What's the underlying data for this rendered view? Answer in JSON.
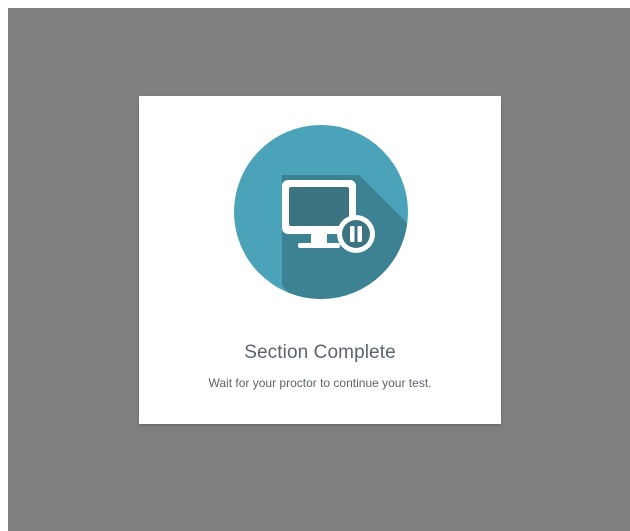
{
  "dialog": {
    "title": "Section Complete",
    "message": "Wait for your proctor to continue your test."
  },
  "illustration": {
    "icon": "monitor-paused-icon",
    "circle_color": "#4aa3b9",
    "shadow_color": "#3a7d8c",
    "screen_color": "#3b7381",
    "outline_color": "#ffffff"
  },
  "colors": {
    "overlay": "#808080",
    "card": "#ffffff",
    "text": "#5c6470"
  }
}
